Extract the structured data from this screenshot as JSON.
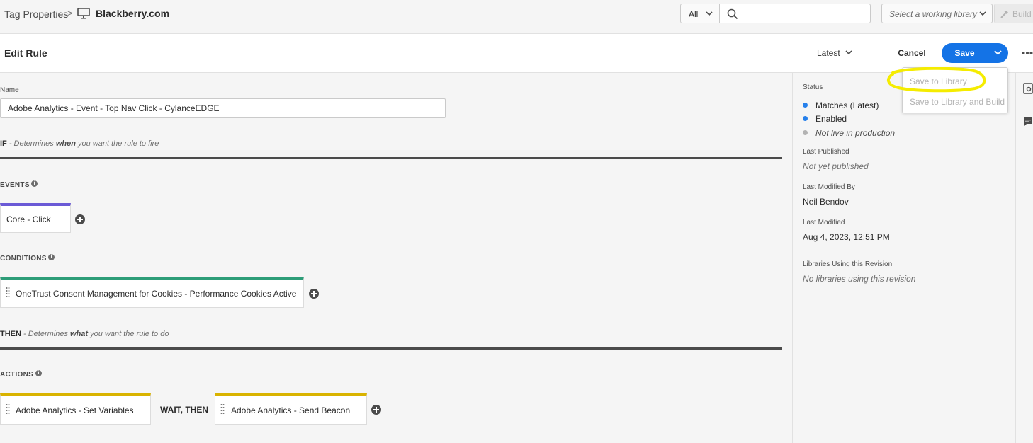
{
  "topbar": {
    "breadcrumb_root": "Tag Properties",
    "breadcrumb_sep": ">",
    "property_name": "Blackberry.com",
    "filter_value": "All",
    "search_value": "",
    "library_placeholder": "Select a working library",
    "build_label": "Build"
  },
  "header": {
    "title": "Edit Rule",
    "revision": "Latest",
    "cancel_label": "Cancel",
    "save_label": "Save"
  },
  "save_menu": {
    "items": [
      "Save to Library",
      "Save to Library and Build"
    ]
  },
  "form": {
    "name_label": "Name",
    "name_value": "Adobe Analytics - Event - Top Nav Click - CylanceEDGE"
  },
  "if_section": {
    "keyword": "IF",
    "desc_pre": " - Determines ",
    "desc_bold": "when",
    "desc_post": " you want the rule to fire"
  },
  "events": {
    "label": "EVENTS",
    "items": [
      {
        "label": "Core - Click",
        "color": "#6b5ad6"
      }
    ]
  },
  "conditions": {
    "label": "CONDITIONS",
    "items": [
      {
        "label": "OneTrust Consent Management for Cookies - Performance Cookies Active",
        "color": "#2d9d78"
      }
    ]
  },
  "then_section": {
    "keyword": "THEN",
    "desc_pre": " - Determines ",
    "desc_bold": "what",
    "desc_post": " you want the rule to do"
  },
  "actions": {
    "label": "ACTIONS",
    "connector": "WAIT, THEN",
    "items": [
      {
        "label": "Adobe Analytics - Set Variables",
        "color": "#d9b300"
      },
      {
        "label": "Adobe Analytics - Send Beacon",
        "color": "#d9b300"
      }
    ]
  },
  "sidebar": {
    "status_label": "Status",
    "status_items": [
      {
        "label": "Matches (Latest)",
        "color": "#2680eb"
      },
      {
        "label": "Enabled",
        "color": "#2680eb"
      },
      {
        "label": "Not live in production",
        "color": "#b3b3b3"
      }
    ],
    "last_published_label": "Last Published",
    "last_published_value": "Not yet published",
    "modified_by_label": "Last Modified By",
    "modified_by_value": "Neil Bendov",
    "last_modified_label": "Last Modified",
    "last_modified_value": "Aug 4, 2023, 12:51 PM",
    "libraries_label": "Libraries Using this Revision",
    "libraries_value": "No libraries using this revision"
  }
}
